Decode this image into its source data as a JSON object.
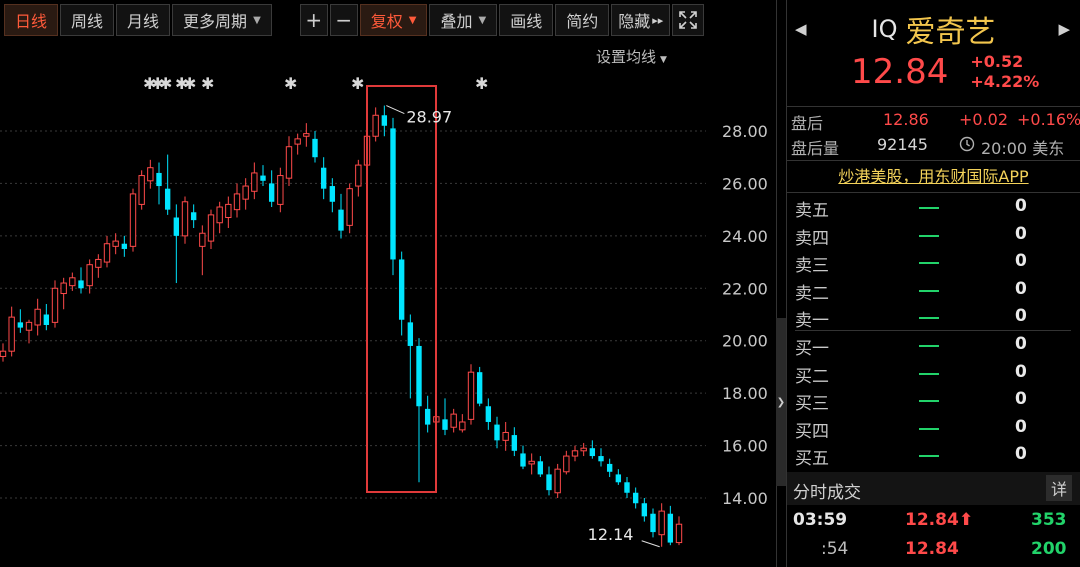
{
  "toolbar": {
    "periods": [
      "日线",
      "周线",
      "月线"
    ],
    "more_periods": "更多周期",
    "plus": "+",
    "minus": "−",
    "adjust": "复权",
    "overlay": "叠加",
    "draw": "画线",
    "simple": "简约",
    "hide": "隐藏",
    "hide_icon": "▸▸",
    "fullscreen_icon": "expand-icon"
  },
  "chart": {
    "ma_setting": "设置均线",
    "y_ticks": [
      "28.00",
      "26.00",
      "24.00",
      "22.00",
      "20.00",
      "18.00",
      "16.00",
      "14.00"
    ],
    "high_label": "28.97",
    "low_label": "12.14",
    "event_marks": 8,
    "colors": {
      "up": "#ff4a4a",
      "down": "#00e5ff",
      "highlight_box": "#e03a3a",
      "grid": "#3a3a3a"
    }
  },
  "chart_data": {
    "type": "candlestick",
    "ylim": [
      12,
      30
    ],
    "y_ticks": [
      28,
      26,
      24,
      22,
      20,
      18,
      16,
      14
    ],
    "annotations": [
      {
        "label": "28.97",
        "value": 28.97
      },
      {
        "label": "12.14",
        "value": 12.14
      }
    ],
    "ohlc": [
      [
        19.4,
        19.9,
        19.2,
        19.6
      ],
      [
        19.6,
        21.3,
        19.4,
        20.9
      ],
      [
        20.7,
        21.2,
        20.3,
        20.5
      ],
      [
        20.4,
        20.8,
        19.9,
        20.7
      ],
      [
        20.6,
        21.6,
        20.2,
        21.2
      ],
      [
        21.0,
        21.4,
        20.4,
        20.6
      ],
      [
        20.7,
        22.3,
        20.5,
        22.0
      ],
      [
        21.8,
        22.4,
        21.2,
        22.2
      ],
      [
        22.1,
        22.6,
        21.9,
        22.4
      ],
      [
        22.3,
        22.8,
        21.8,
        22.0
      ],
      [
        22.1,
        23.1,
        21.8,
        22.9
      ],
      [
        22.8,
        23.3,
        22.4,
        23.1
      ],
      [
        23.0,
        24.0,
        22.8,
        23.7
      ],
      [
        23.6,
        24.1,
        23.3,
        23.8
      ],
      [
        23.7,
        24.0,
        23.2,
        23.5
      ],
      [
        23.6,
        25.8,
        23.4,
        25.6
      ],
      [
        25.2,
        26.5,
        25.0,
        26.3
      ],
      [
        26.1,
        26.9,
        25.8,
        26.6
      ],
      [
        26.4,
        26.8,
        25.2,
        25.9
      ],
      [
        25.8,
        27.1,
        24.8,
        25.0
      ],
      [
        24.7,
        25.2,
        22.2,
        24.0
      ],
      [
        24.0,
        25.5,
        23.7,
        25.3
      ],
      [
        24.9,
        25.2,
        24.3,
        24.6
      ],
      [
        23.6,
        24.4,
        22.5,
        24.1
      ],
      [
        23.8,
        25.0,
        23.5,
        24.8
      ],
      [
        24.5,
        25.3,
        24.1,
        25.1
      ],
      [
        24.7,
        25.5,
        24.3,
        25.2
      ],
      [
        25.0,
        26.0,
        24.7,
        25.6
      ],
      [
        25.4,
        26.2,
        25.0,
        25.9
      ],
      [
        25.7,
        26.8,
        25.4,
        26.4
      ],
      [
        26.3,
        26.7,
        25.9,
        26.1
      ],
      [
        26.0,
        26.5,
        25.1,
        25.3
      ],
      [
        25.2,
        26.6,
        24.9,
        26.3
      ],
      [
        26.2,
        27.8,
        25.9,
        27.4
      ],
      [
        27.5,
        27.9,
        27.1,
        27.7
      ],
      [
        27.8,
        28.3,
        27.4,
        27.9
      ],
      [
        27.7,
        28.0,
        26.8,
        27.0
      ],
      [
        26.6,
        27.0,
        25.4,
        25.8
      ],
      [
        25.9,
        26.2,
        24.9,
        25.3
      ],
      [
        25.0,
        25.6,
        23.9,
        24.2
      ],
      [
        24.4,
        26.0,
        24.1,
        25.8
      ],
      [
        25.9,
        26.9,
        25.5,
        26.7
      ],
      [
        26.7,
        28.1,
        26.4,
        27.8
      ],
      [
        27.8,
        28.9,
        27.6,
        28.6
      ],
      [
        28.6,
        28.97,
        27.8,
        28.2
      ],
      [
        28.1,
        28.5,
        22.5,
        23.1
      ],
      [
        23.1,
        23.4,
        20.2,
        20.8
      ],
      [
        20.7,
        21.0,
        17.8,
        19.8
      ],
      [
        19.8,
        20.1,
        14.6,
        17.5
      ],
      [
        17.4,
        17.9,
        16.5,
        16.8
      ],
      [
        16.9,
        17.6,
        15.8,
        17.1
      ],
      [
        17.0,
        17.8,
        16.4,
        16.6
      ],
      [
        16.7,
        17.4,
        16.5,
        17.2
      ],
      [
        16.6,
        17.2,
        16.5,
        16.9
      ],
      [
        17.0,
        19.1,
        16.8,
        18.8
      ],
      [
        18.8,
        19.0,
        17.5,
        17.6
      ],
      [
        17.5,
        17.8,
        16.6,
        16.9
      ],
      [
        16.8,
        17.1,
        15.9,
        16.2
      ],
      [
        16.2,
        16.9,
        15.8,
        16.5
      ],
      [
        16.4,
        16.7,
        15.6,
        15.8
      ],
      [
        15.7,
        16.0,
        15.1,
        15.2
      ],
      [
        15.3,
        15.7,
        14.9,
        15.4
      ],
      [
        15.4,
        15.6,
        14.8,
        14.9
      ],
      [
        14.9,
        15.2,
        14.1,
        14.3
      ],
      [
        14.2,
        15.3,
        14.0,
        15.1
      ],
      [
        15.0,
        15.8,
        14.9,
        15.6
      ],
      [
        15.6,
        16.0,
        15.4,
        15.8
      ],
      [
        15.8,
        16.1,
        15.6,
        15.9
      ],
      [
        15.9,
        16.2,
        15.5,
        15.6
      ],
      [
        15.6,
        15.9,
        15.2,
        15.4
      ],
      [
        15.3,
        15.5,
        14.8,
        15.0
      ],
      [
        14.9,
        15.1,
        14.5,
        14.6
      ],
      [
        14.6,
        14.8,
        14.0,
        14.2
      ],
      [
        14.2,
        14.4,
        13.6,
        13.8
      ],
      [
        13.8,
        14.0,
        13.1,
        13.3
      ],
      [
        13.4,
        13.6,
        12.5,
        12.7
      ],
      [
        12.6,
        13.8,
        12.14,
        13.5
      ],
      [
        13.4,
        13.7,
        12.2,
        12.3
      ],
      [
        12.3,
        13.3,
        12.2,
        13.0
      ]
    ]
  },
  "stock": {
    "symbol": "IQ",
    "name": "爱奇艺",
    "price": "12.84",
    "change": "+0.52",
    "change_pct": "+4.22%",
    "prev_icon": "chevron-left-icon",
    "next_icon": "chevron-right-icon"
  },
  "after_hours": {
    "label": "盘后",
    "price": "12.86",
    "change": "+0.02",
    "change_pct": "+0.16%",
    "volume_label": "盘后量",
    "volume": "92145",
    "time": "20:00 美东"
  },
  "promo": "炒港美股，用东财国际APP",
  "orderbook": {
    "asks": [
      {
        "label": "卖五",
        "qty": "0"
      },
      {
        "label": "卖四",
        "qty": "0"
      },
      {
        "label": "卖三",
        "qty": "0"
      },
      {
        "label": "卖二",
        "qty": "0"
      },
      {
        "label": "卖一",
        "qty": "0"
      }
    ],
    "bids": [
      {
        "label": "买一",
        "qty": "0"
      },
      {
        "label": "买二",
        "qty": "0"
      },
      {
        "label": "买三",
        "qty": "0"
      },
      {
        "label": "买四",
        "qty": "0"
      },
      {
        "label": "买五",
        "qty": "0"
      }
    ]
  },
  "time_sales": {
    "title": "分时成交",
    "detail_label": "详",
    "rows": [
      {
        "time": "03:59",
        "price": "12.84",
        "arrow": "⬆",
        "vol": "353"
      },
      {
        "time": ":54",
        "price": "12.84",
        "arrow": "",
        "vol": "200"
      }
    ]
  }
}
